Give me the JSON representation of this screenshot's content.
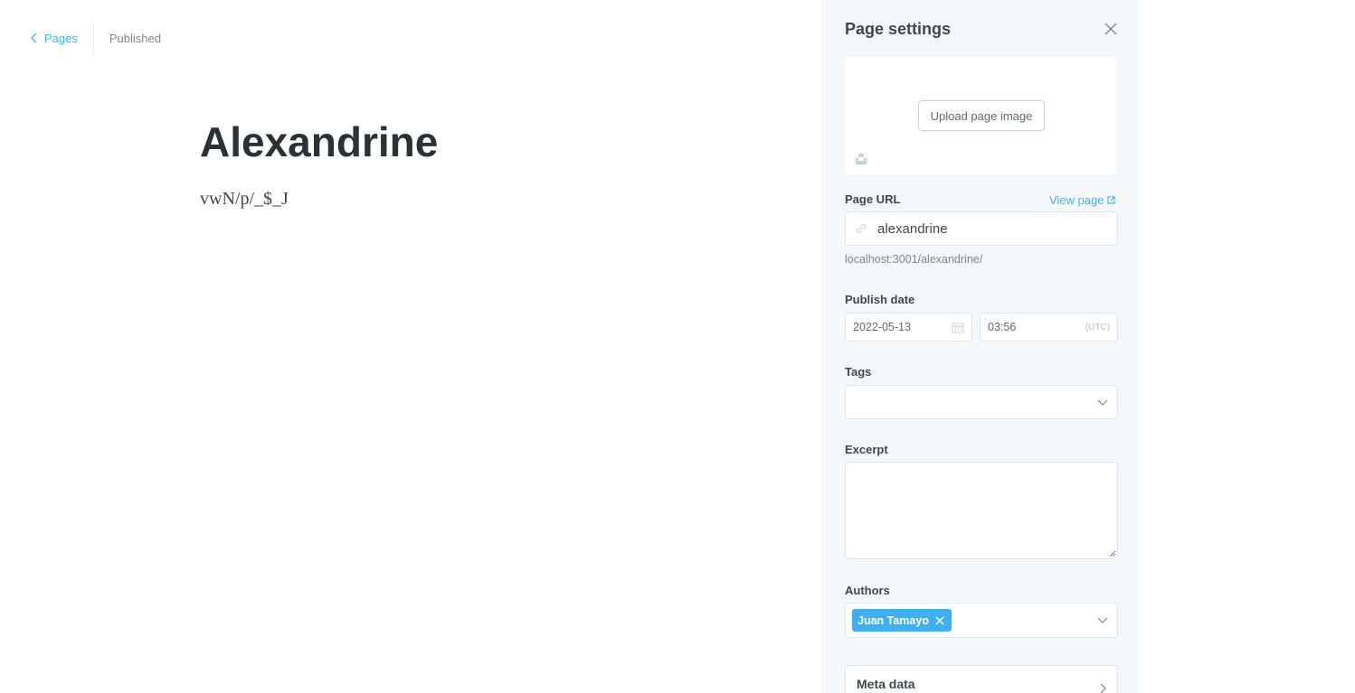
{
  "nav": {
    "back_label": "Pages",
    "status": "Published"
  },
  "editor": {
    "title": "Alexandrine",
    "body": "vwN/p/_$_J"
  },
  "settings": {
    "title": "Page settings",
    "upload_label": "Upload page image",
    "page_url_label": "Page URL",
    "view_page_label": "View page",
    "url_value": "alexandrine",
    "url_hint": "localhost:3001/alexandrine/",
    "publish_date_label": "Publish date",
    "date_value": "2022-05-13",
    "time_value": "03:56",
    "timezone": "(UTC)",
    "tags_label": "Tags",
    "excerpt_label": "Excerpt",
    "excerpt_value": "",
    "authors_label": "Authors",
    "authors": [
      "Juan Tamayo"
    ],
    "meta_data_label": "Meta data"
  },
  "colors": {
    "accent": "#3eb0ef",
    "panel_bg": "#f4f8fb",
    "title_text": "#2b3236"
  },
  "icons": {
    "back": "chevron-left-icon",
    "close": "close-icon",
    "unsplash": "unsplash-icon",
    "external": "external-link-icon",
    "link": "link-icon",
    "calendar": "calendar-icon",
    "dropdown": "chevron-down-icon",
    "remove_author": "remove-icon",
    "meta": "chevron-right-icon"
  }
}
